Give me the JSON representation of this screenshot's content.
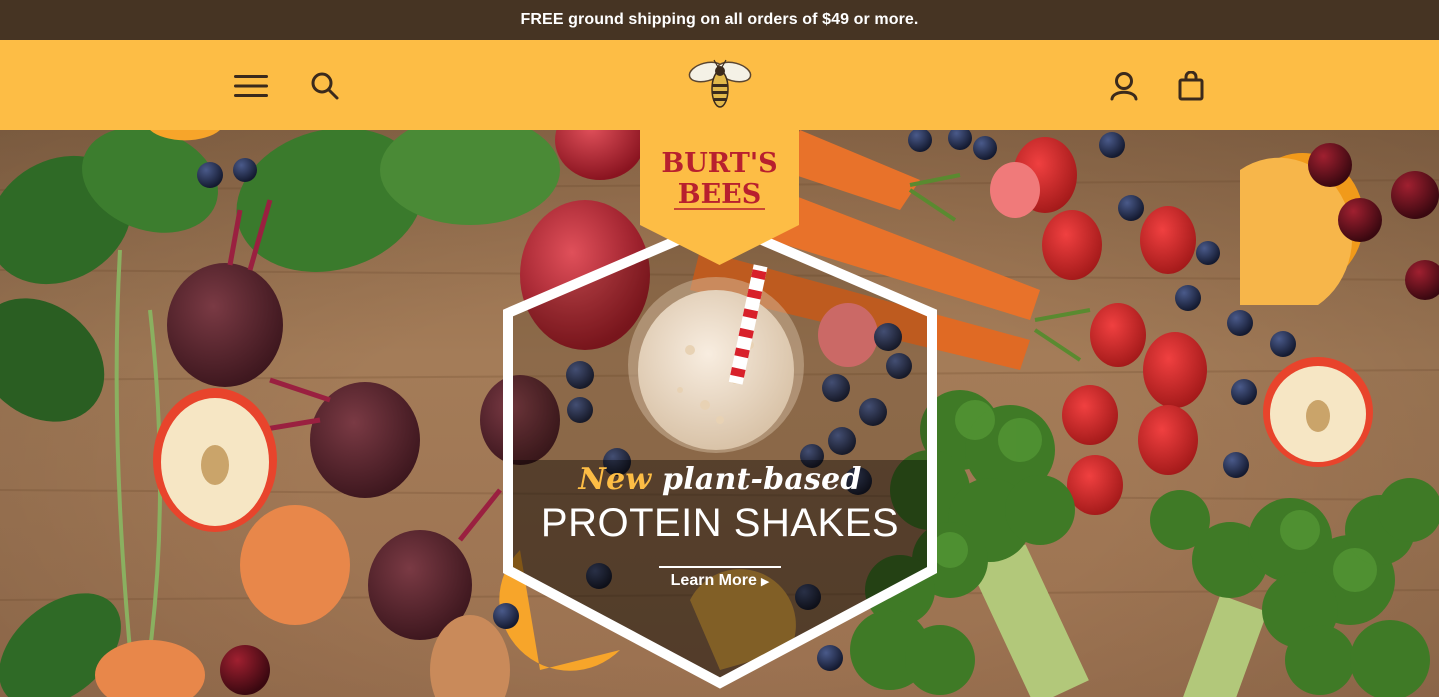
{
  "promo": {
    "text": "FREE ground shipping on all orders of $49 or more."
  },
  "header": {
    "menu_icon": "hamburger-menu-icon",
    "search_icon": "search-icon",
    "logo_icon": "bee-logo-icon",
    "account_icon": "account-icon",
    "cart_icon": "shopping-bag-icon"
  },
  "brand": {
    "line1": "BURT'S",
    "line2": "BEES"
  },
  "hero": {
    "headline_accent": "New",
    "headline_rest": "plant-based",
    "title": "PROTEIN SHAKES",
    "cta_label": "Learn More",
    "cta_icon": "play-triangle-icon"
  },
  "colors": {
    "promo_bg": "#463423",
    "header_bg": "#fdbd45",
    "brand_red": "#b8202e",
    "accent": "#fdbd45"
  }
}
